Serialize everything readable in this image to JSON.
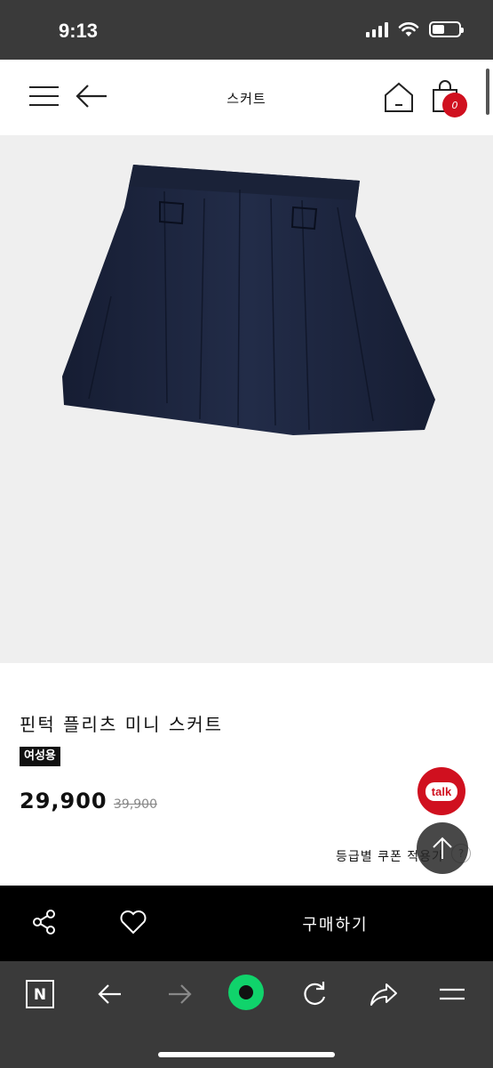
{
  "status_bar": {
    "time": "9:13",
    "battery_level": 0.45
  },
  "header": {
    "title": "스커트",
    "cart_count": "0",
    "icons": [
      "menu-icon",
      "back-arrow-icon",
      "home-icon",
      "shopping-bag-icon"
    ]
  },
  "product": {
    "name": "핀턱 플리츠 미니 스커트",
    "gender_badge": "여성용",
    "price_sale": "29,900",
    "price_original": "39,900",
    "coupon_label": "등급별 쿠폰 적용가",
    "coupon_help": "?"
  },
  "floating": {
    "talk_label": "talk"
  },
  "buy_bar": {
    "buy_label": "구매하기",
    "icons": [
      "share-icon",
      "heart-icon"
    ]
  },
  "browser_bar": {
    "naver_label": "N",
    "icons": [
      "naver-icon",
      "back-icon",
      "forward-icon",
      "green-dot-icon",
      "refresh-icon",
      "share-arrow-icon",
      "menu-icon"
    ]
  },
  "colors": {
    "accent_red": "#d0101f",
    "navy_skirt": "#1d2640",
    "status_bg": "#3a3a3a"
  }
}
